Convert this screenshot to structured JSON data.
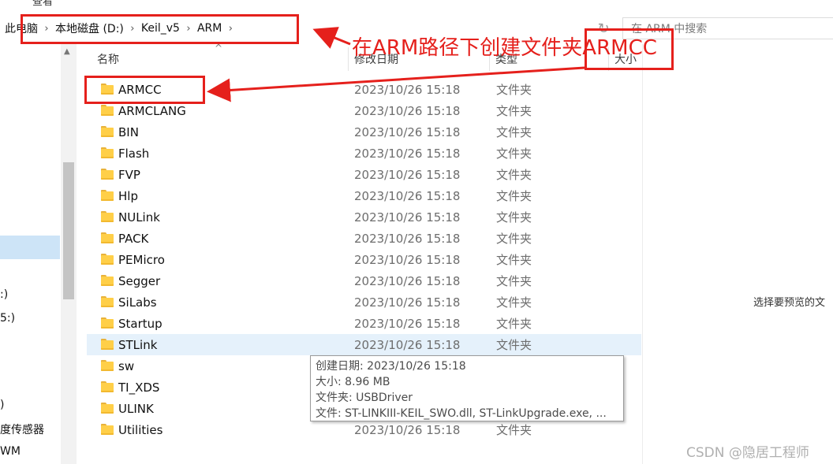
{
  "top_toolbar": {
    "view_tab": "查看"
  },
  "address": {
    "crumbs": [
      "此电脑",
      "本地磁盘 (D:)",
      "Keil_v5",
      "ARM"
    ],
    "search_placeholder": "在 ARM 中搜索"
  },
  "nav": {
    "partial_items": [
      ":)",
      "5:)",
      ")",
      "度传感器",
      "WM"
    ]
  },
  "columns": {
    "name": "名称",
    "date": "修改日期",
    "type": "类型",
    "size": "大小"
  },
  "files": [
    {
      "name": "ARMCC",
      "date": "2023/10/26 15:18",
      "type": "文件夹"
    },
    {
      "name": "ARMCLANG",
      "date": "2023/10/26 15:18",
      "type": "文件夹"
    },
    {
      "name": "BIN",
      "date": "2023/10/26 15:18",
      "type": "文件夹"
    },
    {
      "name": "Flash",
      "date": "2023/10/26 15:18",
      "type": "文件夹"
    },
    {
      "name": "FVP",
      "date": "2023/10/26 15:18",
      "type": "文件夹"
    },
    {
      "name": "Hlp",
      "date": "2023/10/26 15:18",
      "type": "文件夹"
    },
    {
      "name": "NULink",
      "date": "2023/10/26 15:18",
      "type": "文件夹"
    },
    {
      "name": "PACK",
      "date": "2023/10/26 15:18",
      "type": "文件夹"
    },
    {
      "name": "PEMicro",
      "date": "2023/10/26 15:18",
      "type": "文件夹"
    },
    {
      "name": "Segger",
      "date": "2023/10/26 15:18",
      "type": "文件夹"
    },
    {
      "name": "SiLabs",
      "date": "2023/10/26 15:18",
      "type": "文件夹"
    },
    {
      "name": "Startup",
      "date": "2023/10/26 15:18",
      "type": "文件夹"
    },
    {
      "name": "STLink",
      "date": "2023/10/26 15:18",
      "type": "文件夹"
    },
    {
      "name": "sw",
      "date": "",
      "type": ""
    },
    {
      "name": "TI_XDS",
      "date": "",
      "type": ""
    },
    {
      "name": "ULINK",
      "date": "",
      "type": ""
    },
    {
      "name": "Utilities",
      "date": "2023/10/26 15:18",
      "type": "文件夹"
    }
  ],
  "tooltip": {
    "created": "创建日期: 2023/10/26 15:18",
    "size": "大小: 8.96 MB",
    "folders": "文件夹: USBDriver",
    "files": "文件: ST-LINKIII-KEIL_SWO.dll, ST-LinkUpgrade.exe, ..."
  },
  "preview": {
    "message": "选择要预览的文"
  },
  "annotation": {
    "text": "在ARM路径下创建文件夹ARMCC",
    "color": "#e5201c"
  },
  "watermark": "CSDN @隐居工程师",
  "icons": {
    "folder": "folder-icon",
    "refresh": "refresh-icon",
    "chevron": "chevron-right-icon"
  }
}
